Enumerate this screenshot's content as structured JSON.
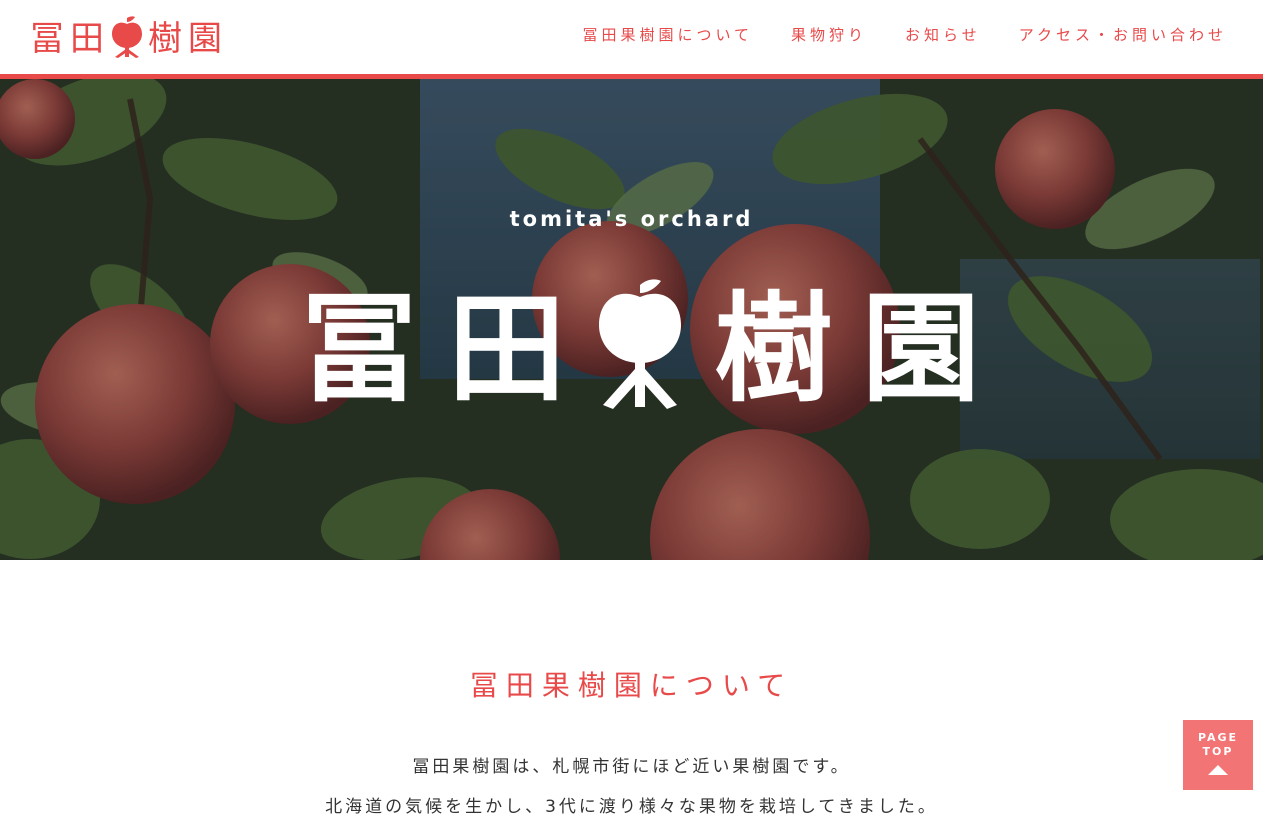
{
  "header": {
    "logo": {
      "chars": [
        "冨",
        "田",
        "果",
        "樹",
        "園"
      ]
    },
    "nav": [
      {
        "label": "冨田果樹園について"
      },
      {
        "label": "果物狩り"
      },
      {
        "label": "お知らせ"
      },
      {
        "label": "アクセス・お問い合わせ"
      }
    ]
  },
  "hero": {
    "subtitle": "tomita's orchard",
    "title_chars": [
      "冨",
      "田",
      "果",
      "樹",
      "園"
    ]
  },
  "about": {
    "title": "冨田果樹園について",
    "paragraphs": [
      "冨田果樹園は、札幌市街にほど近い果樹園です。",
      "北海道の気候を生かし、3代に渡り様々な果物を栽培してきました。"
    ]
  },
  "page_top": {
    "line1": "PAGE",
    "line2": "TOP"
  },
  "colors": {
    "accent": "#e84a4a",
    "page_top_bg": "#f27474",
    "text": "#333333"
  },
  "icons": {
    "logo_apple": "apple-icon",
    "hero_apple": "apple-icon",
    "page_top": "triangle-up-icon"
  }
}
